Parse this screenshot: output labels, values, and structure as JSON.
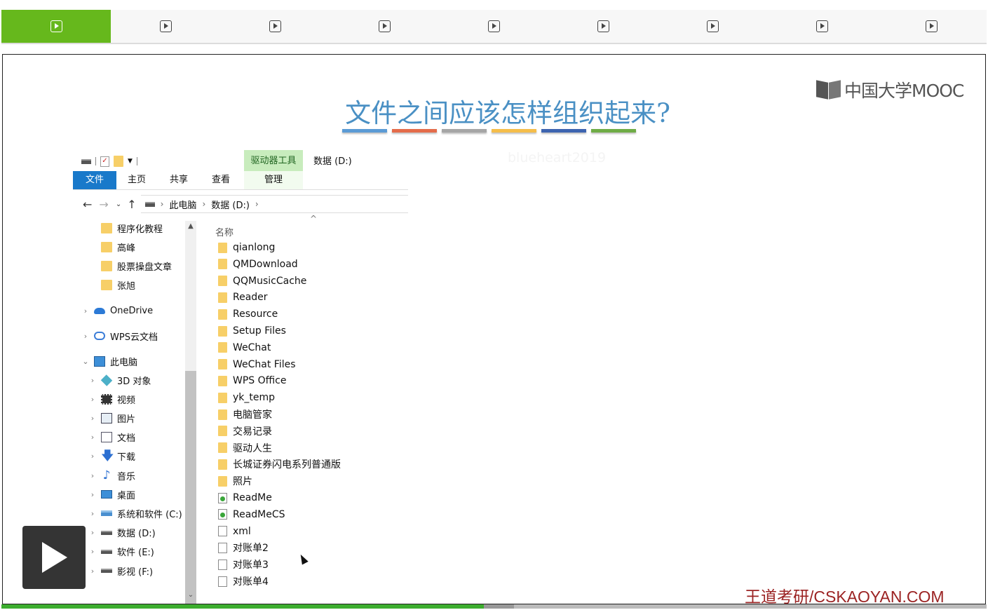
{
  "player": {
    "chapter_tab_count": 9,
    "active_tab_index": 0,
    "progress_fraction": 0.49,
    "buffered_fraction": 0.52
  },
  "slide": {
    "logo_text": "中国大学MOOC",
    "title": "文件之间应该怎样组织起来?",
    "title_color": "#4a90c4",
    "color_bars": [
      "#5b9bd5",
      "#e46c4a",
      "#a6a6a6",
      "#f5bd4a",
      "#3d64b0",
      "#6fac46"
    ],
    "watermark": "blueheart2019",
    "footer_brand": "王道考研/CSKAOYAN.COM"
  },
  "explorer": {
    "ribbon_context_group": "驱动器工具",
    "window_title": "数据 (D:)",
    "ribbon_tabs": [
      "文件",
      "主页",
      "共享",
      "查看",
      "管理"
    ],
    "address_path": [
      "此电脑",
      "数据 (D:)"
    ],
    "nav_pane": {
      "pinned": [
        "程序化教程",
        "高峰",
        "股票操盘文章",
        "张旭"
      ],
      "onedrive": "OneDrive",
      "wps": "WPS云文档",
      "this_pc": "此电脑",
      "pc_items": [
        "3D 对象",
        "视频",
        "图片",
        "文档",
        "下载",
        "音乐",
        "桌面",
        "系统和软件 (C:)",
        "数据 (D:)",
        "软件 (E:)",
        "影视 (F:)"
      ]
    },
    "column_header": "名称",
    "files": [
      {
        "name": "qianlong",
        "kind": "folder"
      },
      {
        "name": "QMDownload",
        "kind": "folder"
      },
      {
        "name": "QQMusicCache",
        "kind": "folder"
      },
      {
        "name": "Reader",
        "kind": "folder"
      },
      {
        "name": "Resource",
        "kind": "folder"
      },
      {
        "name": "Setup Files",
        "kind": "folder"
      },
      {
        "name": "WeChat",
        "kind": "folder"
      },
      {
        "name": "WeChat Files",
        "kind": "folder"
      },
      {
        "name": "WPS Office",
        "kind": "folder"
      },
      {
        "name": "yk_temp",
        "kind": "folder"
      },
      {
        "name": "电脑管家",
        "kind": "folder"
      },
      {
        "name": "交易记录",
        "kind": "folder"
      },
      {
        "name": "驱动人生",
        "kind": "folder"
      },
      {
        "name": "长城证券闪电系列普通版",
        "kind": "folder"
      },
      {
        "name": "照片",
        "kind": "folder"
      },
      {
        "name": "ReadMe",
        "kind": "app-file"
      },
      {
        "name": "ReadMeCS",
        "kind": "app-file"
      },
      {
        "name": "xml",
        "kind": "file"
      },
      {
        "name": "对账单2",
        "kind": "file"
      },
      {
        "name": "对账单3",
        "kind": "file"
      },
      {
        "name": "对账单4",
        "kind": "file"
      }
    ]
  }
}
